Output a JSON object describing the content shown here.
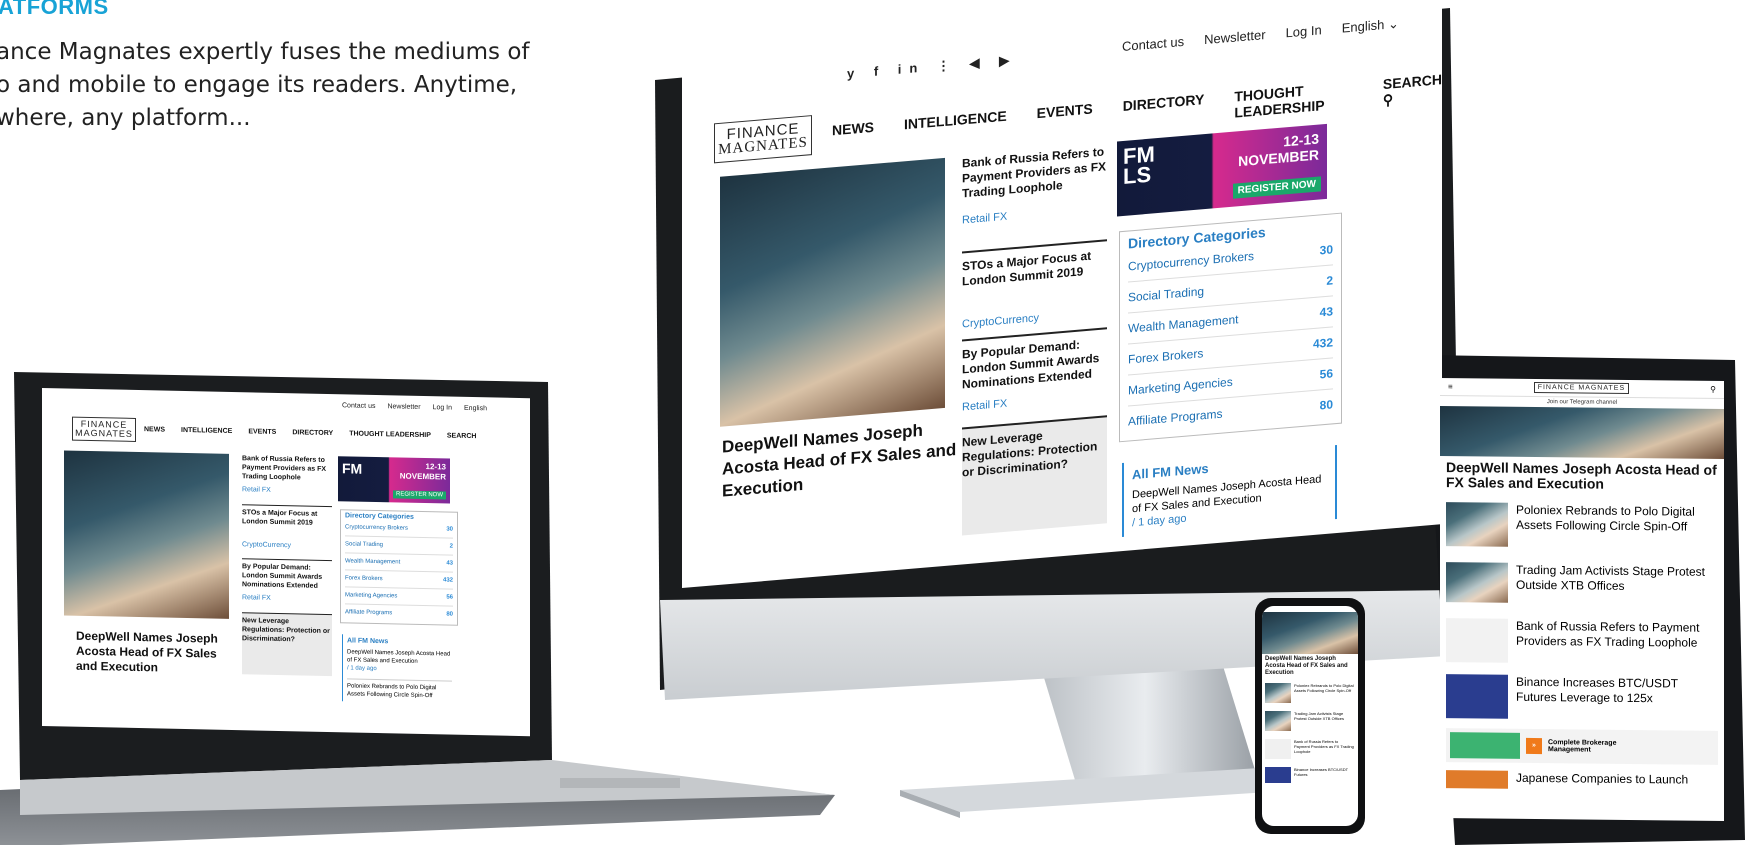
{
  "intro": {
    "heading": "ATFORMS",
    "lines": [
      "ance Magnates expertly fuses the mediums of",
      "o and mobile to engage its readers. Anytime,",
      "where, any platform..."
    ]
  },
  "site": {
    "logo_top": "FINANCE",
    "logo_bottom": "MAGNATES",
    "top_links": [
      "Contact us",
      "Newsletter",
      "Log In",
      "English"
    ],
    "nav": [
      "NEWS",
      "INTELLIGENCE",
      "EVENTS",
      "DIRECTORY",
      "THOUGHT LEADERSHIP",
      "SEARCH"
    ],
    "featured_title": "DeepWell Names Joseph Acosta Head of FX Sales and Execution",
    "featured_line1": "DeepWell Names Joseph",
    "featured_line2": "Acosta Head of FX Sales and",
    "featured_line3": "Execution",
    "mid_stories": [
      {
        "title": "Bank of Russia Refers to Payment Providers as FX Trading Loophole",
        "tag": "Retail FX"
      },
      {
        "title": "STOs a Major Focus at London Summit 2019",
        "tag": "CryptoCurrency"
      },
      {
        "title": "By Popular Demand: London Summit Awards Nominations Extended",
        "tag": "Retail FX"
      },
      {
        "title": "New Leverage Regulations: Protection or Discrimination?",
        "tag": ""
      }
    ],
    "banner": {
      "brand1": "FM",
      "brand2": "LS",
      "date": "12-13",
      "month": "NOVEMBER",
      "cta": "REGISTER NOW"
    },
    "directory": {
      "title": "Directory Categories",
      "rows": [
        {
          "label": "Cryptocurrency Brokers",
          "count": "30"
        },
        {
          "label": "Social Trading",
          "count": "2"
        },
        {
          "label": "Wealth Management",
          "count": "43"
        },
        {
          "label": "Forex Brokers",
          "count": "432"
        },
        {
          "label": "Marketing Agencies",
          "count": "56"
        },
        {
          "label": "Affiliate Programs",
          "count": "80"
        }
      ]
    },
    "news": {
      "title": "All FM News",
      "item": "DeepWell Names Joseph Acosta Head of FX Sales and Execution",
      "time": "/ 1 day ago",
      "item2": "Poloniex Rebrands to Polo Digital Assets Following Circle Spin-Off"
    }
  },
  "tablet": {
    "logo": "FINANCE MAGNATES",
    "telegram": "Join our Telegram channel",
    "headline": "DeepWell Names Joseph Acosta Head of FX Sales and Execution",
    "stories": [
      "Poloniex Rebrands to Polo Digital Assets Following Circle Spin-Off",
      "Trading Jam Activists Stage Protest Outside XTB Offices",
      "Bank of Russia Refers to Payment Providers as FX Trading Loophole",
      "Binance Increases BTC/USDT Futures Leverage to 125x"
    ],
    "ad_title": "Complete Brokerage Management",
    "last_story": "Japanese Companies to Launch"
  },
  "phone": {
    "headline": "DeepWell Names Joseph Acosta Head of FX Sales and Execution",
    "stories": [
      "Poloniex Rebrands to Polo Digital Assets Following Circle Spin-Off",
      "Trading Jam Activists Stage Protest Outside XTB Offices",
      "Bank of Russia Refers to Payment Providers as FX Trading Loophole",
      "Binance Increases BTC/USDT Futures"
    ]
  },
  "colors": {
    "accent": "#18a3d6",
    "link": "#2a7fc3",
    "banner_pink": "#d62a8d",
    "banner_navy": "#121a3a"
  }
}
